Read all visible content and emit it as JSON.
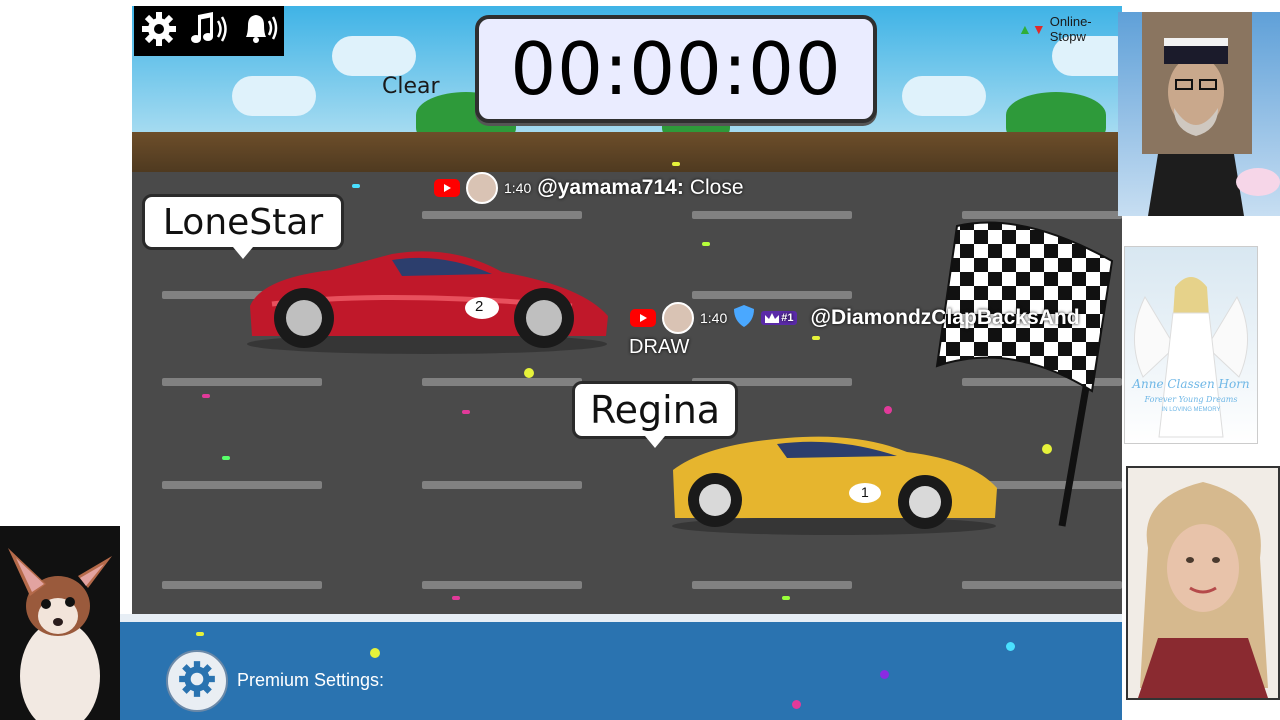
{
  "toolbar": {
    "icons": [
      "gear-icon",
      "music-icon",
      "bell-icon"
    ]
  },
  "header": {
    "site_label": "Online-Stopw",
    "clear_label": "Clear"
  },
  "timer": {
    "value": "00:00:00"
  },
  "racers": [
    {
      "name": "LoneStar",
      "number": "2",
      "color": "#c0182a"
    },
    {
      "name": "Regina",
      "number": "1",
      "color": "#e6b52e"
    }
  ],
  "chat": [
    {
      "time": "1:40",
      "user": "@yamama714:",
      "message": "Close"
    },
    {
      "time": "1:40",
      "user": "@DiamondzClapBacksAnd",
      "status": "DRAW",
      "badge": "#1"
    }
  ],
  "bottom": {
    "premium_label": "Premium Settings:"
  },
  "overlay": {
    "poster_title": "Anne Classen Horn",
    "poster_subtitle": "Forever Young Dreams",
    "poster_note": "IN LOVING MEMORY"
  },
  "colors": {
    "sky": "#3fb3e6",
    "road": "#4a4a4a",
    "bottom_bar": "#2a73b0",
    "youtube_red": "#ff0000"
  }
}
